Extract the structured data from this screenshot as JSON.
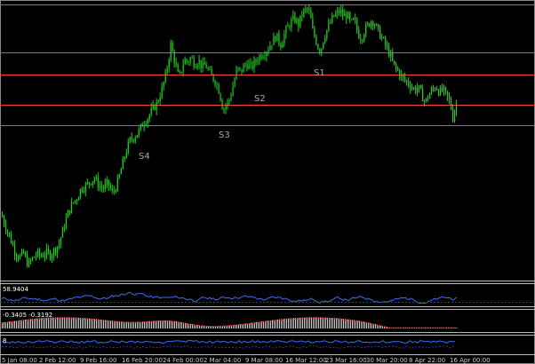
{
  "chart_data": {
    "type": "candlestick",
    "main": {
      "up_color": "#22cc22",
      "down_color": "#22cc22",
      "close_path": [
        [
          0,
          1.1035
        ],
        [
          5,
          1.0985
        ],
        [
          10,
          1.094
        ],
        [
          15,
          1.089
        ],
        [
          20,
          1.0865
        ],
        [
          25,
          1.088
        ],
        [
          30,
          1.0835
        ],
        [
          35,
          1.086
        ],
        [
          40,
          1.088
        ],
        [
          45,
          1.087
        ],
        [
          50,
          1.0885
        ],
        [
          55,
          1.0875
        ],
        [
          60,
          1.0895
        ],
        [
          65,
          1.092
        ],
        [
          70,
          1.098
        ],
        [
          75,
          1.104
        ],
        [
          80,
          1.108
        ],
        [
          85,
          1.11
        ],
        [
          90,
          1.114
        ],
        [
          95,
          1.115
        ],
        [
          100,
          1.1165
        ],
        [
          105,
          1.118
        ],
        [
          110,
          1.115
        ],
        [
          115,
          1.114
        ],
        [
          120,
          1.116
        ],
        [
          125,
          1.112
        ],
        [
          130,
          1.115
        ],
        [
          135,
          1.1215
        ],
        [
          140,
          1.128
        ],
        [
          145,
          1.133
        ],
        [
          150,
          1.1345
        ],
        [
          155,
          1.1365
        ],
        [
          160,
          1.14
        ],
        [
          165,
          1.142
        ],
        [
          170,
          1.145
        ],
        [
          175,
          1.1475
        ],
        [
          180,
          1.152
        ],
        [
          185,
          1.1585
        ],
        [
          188,
          1.164
        ],
        [
          191,
          1.171
        ],
        [
          194,
          1.1665
        ],
        [
          197,
          1.162
        ],
        [
          200,
          1.1575
        ],
        [
          203,
          1.161
        ],
        [
          206,
          1.165
        ],
        [
          210,
          1.164
        ],
        [
          214,
          1.166
        ],
        [
          218,
          1.163
        ],
        [
          222,
          1.165
        ],
        [
          226,
          1.162
        ],
        [
          230,
          1.163
        ],
        [
          234,
          1.16
        ],
        [
          238,
          1.158
        ],
        [
          242,
          1.156
        ],
        [
          246,
          1.152
        ],
        [
          250,
          1.145
        ],
        [
          254,
          1.1475
        ],
        [
          258,
          1.15
        ],
        [
          262,
          1.156
        ],
        [
          266,
          1.1615
        ],
        [
          270,
          1.16
        ],
        [
          274,
          1.163
        ],
        [
          278,
          1.163
        ],
        [
          282,
          1.162
        ],
        [
          286,
          1.164
        ],
        [
          290,
          1.166
        ],
        [
          295,
          1.1675
        ],
        [
          300,
          1.169
        ],
        [
          305,
          1.172
        ],
        [
          310,
          1.1745
        ],
        [
          315,
          1.171
        ],
        [
          320,
          1.176
        ],
        [
          325,
          1.179
        ],
        [
          330,
          1.1815
        ],
        [
          335,
          1.179
        ],
        [
          340,
          1.184
        ],
        [
          345,
          1.185
        ],
        [
          348,
          1.183
        ],
        [
          351,
          1.1765
        ],
        [
          354,
          1.1735
        ],
        [
          357,
          1.17
        ],
        [
          360,
          1.1685
        ],
        [
          363,
          1.173
        ],
        [
          366,
          1.176
        ],
        [
          370,
          1.179
        ],
        [
          374,
          1.182
        ],
        [
          378,
          1.183
        ],
        [
          382,
          1.1845
        ],
        [
          386,
          1.182
        ],
        [
          390,
          1.183
        ],
        [
          394,
          1.179
        ],
        [
          398,
          1.181
        ],
        [
          402,
          1.1755
        ],
        [
          406,
          1.1735
        ],
        [
          410,
          1.177
        ],
        [
          414,
          1.179
        ],
        [
          418,
          1.181
        ],
        [
          422,
          1.1785
        ],
        [
          426,
          1.1755
        ],
        [
          430,
          1.173
        ],
        [
          434,
          1.17
        ],
        [
          438,
          1.167
        ],
        [
          442,
          1.163
        ],
        [
          446,
          1.161
        ],
        [
          450,
          1.159
        ],
        [
          454,
          1.157
        ],
        [
          458,
          1.156
        ],
        [
          462,
          1.1545
        ],
        [
          466,
          1.153
        ],
        [
          470,
          1.154
        ],
        [
          474,
          1.151
        ],
        [
          478,
          1.148
        ],
        [
          482,
          1.151
        ],
        [
          486,
          1.153
        ],
        [
          490,
          1.1545
        ],
        [
          494,
          1.152
        ],
        [
          498,
          1.153
        ],
        [
          502,
          1.1505
        ],
        [
          506,
          1.148
        ],
        [
          509,
          1.142
        ],
        [
          512,
          1.147
        ]
      ],
      "xlim": [
        0,
        516
      ],
      "ylim": [
        1.078,
        1.188
      ]
    },
    "levels": [
      {
        "name": "",
        "price": 1.187,
        "color": "#ff4444"
      },
      {
        "name": "S1",
        "price": 1.168,
        "color": "#ff4444"
      },
      {
        "name": "S2",
        "price": 1.159,
        "color": "#ff4444"
      },
      {
        "name": "S3",
        "price": 1.147,
        "color": "#ff4444"
      },
      {
        "name": "S4",
        "price": 1.139,
        "color": "#ff4444"
      }
    ],
    "indicators": [
      {
        "label": "58.9404",
        "color": "#3a6bff",
        "type": "line"
      },
      {
        "label": "-0.3405 -0.3192",
        "color": "#ffffff",
        "type": "histogram",
        "signal_color": "#ff3333"
      },
      {
        "label": "8",
        "color": "#3a6bff",
        "type": "line"
      }
    ],
    "x_tick_labels": [
      "5 Jan 08:00",
      "2 Feb 12:00",
      "9 Feb 16:00",
      "16 Feb 20:00",
      "24 Feb 00:00",
      "2 Mar 04:00",
      "9 Mar 08:00",
      "16 Mar 12:00",
      "23 Mar 16:00",
      "30 Mar 20:00",
      "8 Apr 22:00",
      "16 Apr 00:00"
    ],
    "grid": false
  }
}
